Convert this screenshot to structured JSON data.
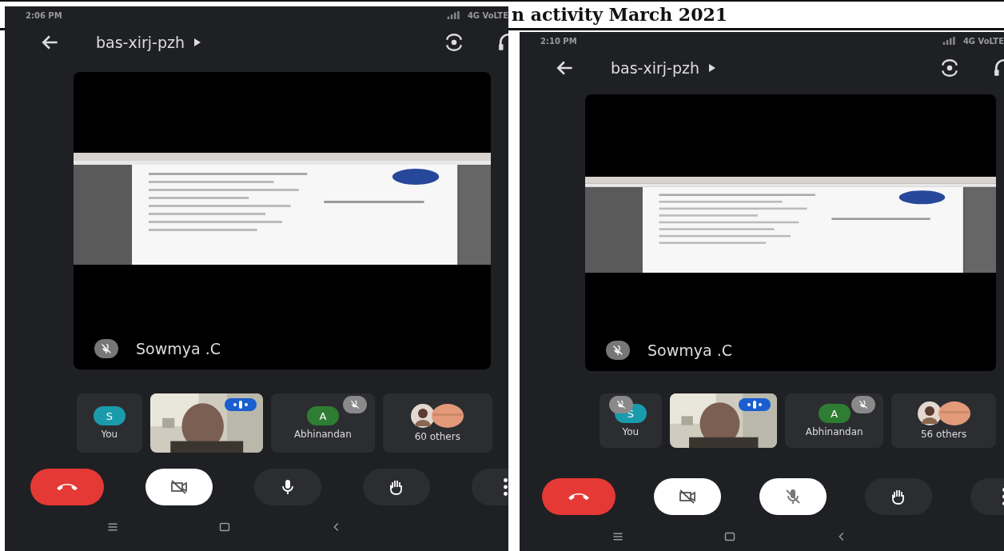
{
  "heading": "n activity March 2021",
  "phones": [
    {
      "time": "2:06 PM",
      "network": "4G VoLTE",
      "meeting_code": "bas-xirj-pzh",
      "presenter": "Sowmya .C",
      "tiles": [
        {
          "kind": "avatar",
          "initial": "S",
          "label": "You",
          "color": "#1a9bab",
          "muted": false
        },
        {
          "kind": "video"
        },
        {
          "kind": "avatar",
          "initial": "A",
          "label": "Abhinandan",
          "color": "#2e7d32",
          "muted": true
        },
        {
          "kind": "others",
          "label": "60 others"
        }
      ],
      "controls": [
        {
          "kind": "end-call"
        },
        {
          "kind": "camera",
          "on": false
        },
        {
          "kind": "mic",
          "on": true
        },
        {
          "kind": "hand"
        },
        {
          "kind": "more"
        }
      ]
    },
    {
      "time": "2:10 PM",
      "network": "4G VoLTE",
      "meeting_code": "bas-xirj-pzh",
      "presenter": "Sowmya .C",
      "tiles": [
        {
          "kind": "avatar",
          "initial": "S",
          "label": "You",
          "color": "#1a9bab",
          "muted": true
        },
        {
          "kind": "video"
        },
        {
          "kind": "avatar",
          "initial": "A",
          "label": "Abhinandan",
          "color": "#2e7d32",
          "muted": true
        },
        {
          "kind": "others",
          "label": "56 others"
        }
      ],
      "controls": [
        {
          "kind": "end-call"
        },
        {
          "kind": "camera",
          "on": false
        },
        {
          "kind": "mic",
          "on": false
        },
        {
          "kind": "hand"
        },
        {
          "kind": "more"
        }
      ]
    }
  ]
}
